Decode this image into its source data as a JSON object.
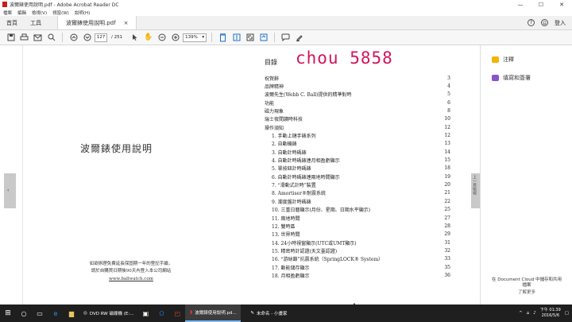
{
  "window": {
    "title": "波爾錶使用說明.pdf - Adobe Acrobat Reader DC",
    "controls": [
      "—",
      "☐",
      "✕"
    ]
  },
  "menu": [
    "檔案",
    "編輯",
    "檢視(V)",
    "視窗(W)",
    "說明(H)"
  ],
  "tabs": {
    "home": "首頁",
    "tools": "工具",
    "doc": "波爾錶使用說明.pdf",
    "close": "×",
    "help": "?",
    "signin": "登入"
  },
  "toolbar": {
    "page_current": "127",
    "page_total": "/ 251",
    "zoom": "139%"
  },
  "page": {
    "title": "波爾錶使用說明",
    "note_line1": "如欲辦理免費延長保固期一年的登記手續，",
    "note_line2": "請於自購買日期後90天內登入本公司網站",
    "url": "www.ballwatch.com",
    "handwriting": "chou 5858",
    "toc_heading": "目錄"
  },
  "toc": [
    {
      "label": "祝賀辭",
      "page": "3",
      "sub": false
    },
    {
      "label": "品牌精神",
      "page": "4",
      "sub": false
    },
    {
      "label": "波爾先生(Webb C. Ball)提供的精準對時",
      "page": "5",
      "sub": false
    },
    {
      "label": "功能",
      "page": "6",
      "sub": false
    },
    {
      "label": "磁力現象",
      "page": "8",
      "sub": false
    },
    {
      "label": "瑞士夜間讀時科技",
      "page": "10",
      "sub": false
    },
    {
      "label": "操作須知",
      "page": "12",
      "sub": false
    },
    {
      "label": "1.   手動上鏈手錶系列",
      "page": "12",
      "sub": true
    },
    {
      "label": "2.   自動機錶",
      "page": "13",
      "sub": true
    },
    {
      "label": "3.   自動計時碼錶",
      "page": "14",
      "sub": true
    },
    {
      "label": "4.   自動計時碼錶連月相盈虧顯示",
      "page": "15",
      "sub": true
    },
    {
      "label": "5.   單按鈕計時碼錶",
      "page": "18",
      "sub": true
    },
    {
      "label": "6.   自動計時碼錶連兩地時間顯示",
      "page": "19",
      "sub": true
    },
    {
      "label": "7.   “滑動式計時”裝置",
      "page": "20",
      "sub": true
    },
    {
      "label": "8.   Amortiser®耐震系統",
      "page": "21",
      "sub": true
    },
    {
      "label": "9.   潮度盤計時碼錶",
      "page": "22",
      "sub": true
    },
    {
      "label": "10. 三重日曆顯示(月份、星期、日期水平顯示)",
      "page": "25",
      "sub": true
    },
    {
      "label": "11. 兩地時間",
      "page": "27",
      "sub": true
    },
    {
      "label": "12. 雙時區",
      "page": "28",
      "sub": true
    },
    {
      "label": "13. 世界時間",
      "page": "29",
      "sub": true
    },
    {
      "label": "14. 24小時視窗顯示(UTC或UMT顯示)",
      "page": "31",
      "sub": true
    },
    {
      "label": "15. 精密時計認證(天文臺認證)",
      "page": "32",
      "sub": true
    },
    {
      "label": "16. “游絲鎖”抗震系統（SpringLOCK® System）",
      "page": "33",
      "sub": true
    },
    {
      "label": "17. 動能儲存顯示",
      "page": "35",
      "sub": true
    },
    {
      "label": "18. 月相盈虧顯示",
      "page": "36",
      "sub": true
    }
  ],
  "right_panel": {
    "comment": "注釋",
    "fill_sign": "填寫和簽署",
    "side_tab": "上一頁檢視",
    "cloud_line1": "在 Document Cloud 中儲存和共用",
    "cloud_line2": "檔案",
    "cloud_more": "了解更多"
  },
  "taskbar": {
    "apps": [
      {
        "label": "DVD RW 磁碟機 (E:...",
        "active": false
      },
      {
        "label": "波爾錶使用說明.pd...",
        "active": true
      },
      {
        "label": "未命名 - 小畫家",
        "active": false
      }
    ],
    "time": "下午 01:39",
    "date": "2016/5/6"
  },
  "colors": {
    "handwriting": "#d4145a",
    "taskbar": "#1f1f1f",
    "accent": "#1d6fc9"
  }
}
